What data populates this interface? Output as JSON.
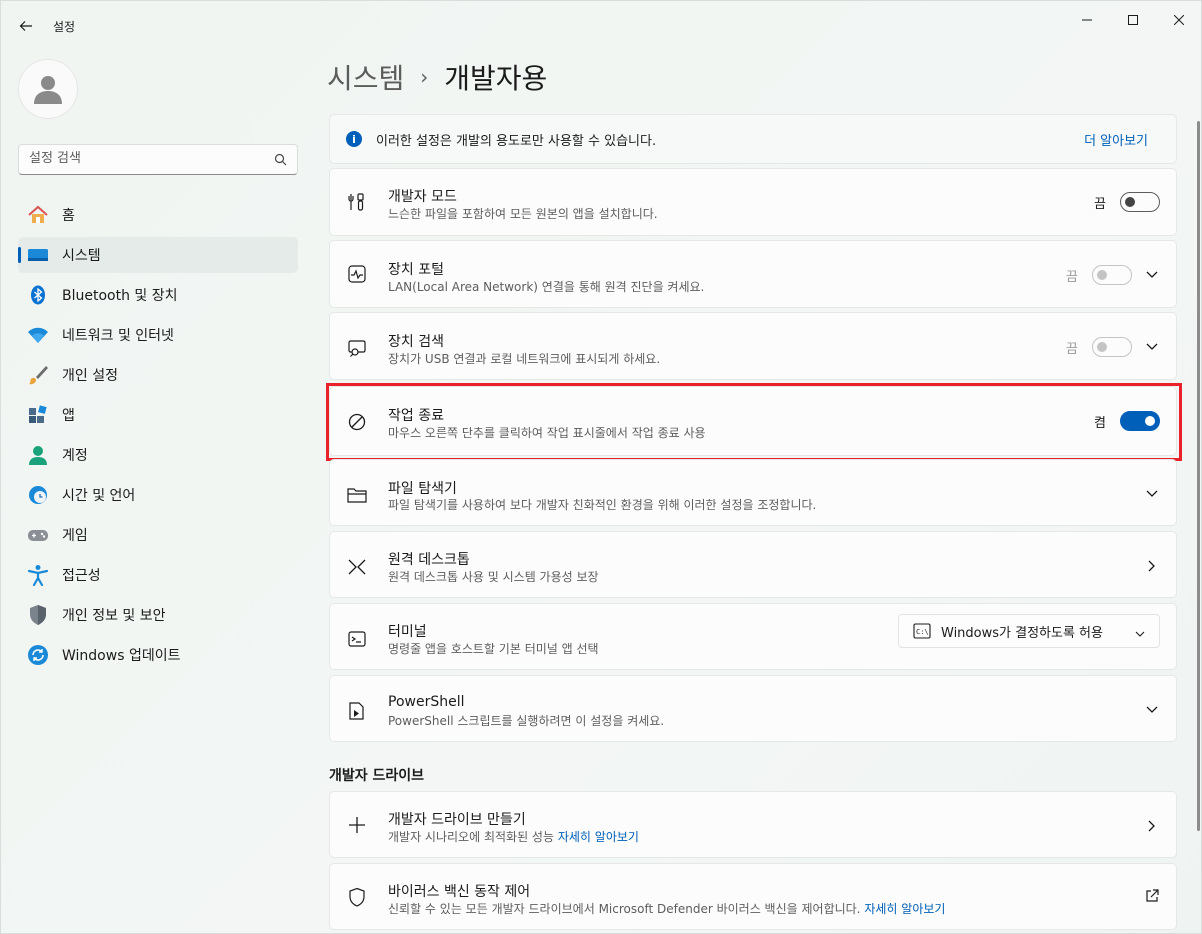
{
  "window": {
    "app_title": "설정"
  },
  "sidebar": {
    "search_placeholder": "설정 검색",
    "items": [
      {
        "label": "홈",
        "icon": "home-icon"
      },
      {
        "label": "시스템",
        "icon": "system-icon",
        "selected": true
      },
      {
        "label": "Bluetooth 및 장치",
        "icon": "bluetooth-icon"
      },
      {
        "label": "네트워크 및 인터넷",
        "icon": "wifi-icon"
      },
      {
        "label": "개인 설정",
        "icon": "brush-icon"
      },
      {
        "label": "앱",
        "icon": "apps-icon"
      },
      {
        "label": "계정",
        "icon": "account-icon"
      },
      {
        "label": "시간 및 언어",
        "icon": "clock-globe-icon"
      },
      {
        "label": "게임",
        "icon": "gamepad-icon"
      },
      {
        "label": "접근성",
        "icon": "accessibility-icon"
      },
      {
        "label": "개인 정보 및 보안",
        "icon": "shield-icon"
      },
      {
        "label": "Windows 업데이트",
        "icon": "update-icon"
      }
    ]
  },
  "breadcrumb": {
    "parent": "시스템",
    "separator": "›",
    "current": "개발자용"
  },
  "info_bar": {
    "icon_text": "i",
    "text": "이러한 설정은 개발의 용도로만 사용할 수 있습니다.",
    "link": "더 알아보기"
  },
  "settings": {
    "developer_mode": {
      "title": "개발자 모드",
      "desc": "느슨한 파일을 포함하여 모든 원본의 앱을 설치합니다.",
      "state": "끔"
    },
    "device_portal": {
      "title": "장치 포털",
      "desc": "LAN(Local Area Network) 연결을 통해 원격 진단을 켜세요.",
      "state": "끔"
    },
    "device_discovery": {
      "title": "장치 검색",
      "desc": "장치가 USB 연결과 로컬 네트워크에 표시되게 하세요.",
      "state": "끔"
    },
    "end_task": {
      "title": "작업 종료",
      "desc": "마우스 오른쪽 단추를 클릭하여 작업 표시줄에서 작업 종료 사용",
      "state": "켬"
    },
    "file_explorer": {
      "title": "파일 탐색기",
      "desc": "파일 탐색기를 사용하여 보다 개발자 친화적인 환경을 위해 이러한 설정을 조정합니다."
    },
    "remote_desktop": {
      "title": "원격 데스크톱",
      "desc": "원격 데스크톱 사용 및 시스템 가용성 보장"
    },
    "terminal": {
      "title": "터미널",
      "desc": "명령줄 앱을 호스트할 기본 터미널 앱 선택",
      "dropdown_value": "Windows가 결정하도록 허용"
    },
    "powershell": {
      "title": "PowerShell",
      "desc": "PowerShell 스크립트를 실행하려면 이 설정을 켜세요."
    }
  },
  "dev_drive": {
    "section_title": "개발자 드라이브",
    "create": {
      "title": "개발자 드라이브 만들기",
      "desc": "개발자 시나리오에 최적화된 성능",
      "link": "자세히 알아보기"
    },
    "antivirus": {
      "title": "바이러스 백신 동작 제어",
      "desc": "신뢰할 수 있는 모든 개발자 드라이브에서 Microsoft Defender 바이러스 백신을 제어합니다.",
      "link": "자세히 알아보기"
    }
  },
  "colors": {
    "accent": "#005fb8",
    "highlight_box": "#e8212b"
  }
}
